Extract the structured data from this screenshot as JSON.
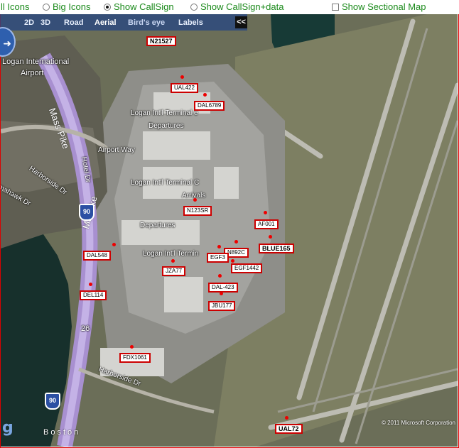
{
  "options": {
    "all_icons": "ll Icons",
    "big_icons": "Big Icons",
    "show_callsign": "Show CallSign",
    "show_callsign_data": "Show CallSign+data",
    "show_sectional_map": "Show Sectional Map"
  },
  "map_toolbar": {
    "view_2d": "2D",
    "view_3d": "3D",
    "road": "Road",
    "aerial": "Aerial",
    "birds_eye": "Bird's eye",
    "labels": "Labels",
    "collapse": "<<"
  },
  "map_labels": {
    "logan_intl": "Logan International",
    "airport": "Airport",
    "terminal_e": "Logan Int'l Terminal e",
    "departures_1": "Departures",
    "airport_way": "Airport Way",
    "terminal_c": "Logan Int'l Terminal C",
    "arrivals": "Arrivals",
    "departures_2": "Departures",
    "terminal_partial": "Logan Int'l Termin",
    "hotel_dr": "Hotel Dr",
    "harborside_dr_1": "Harborside Dr",
    "harborside_dr_2": "Harborside Dr",
    "mahawk_dr": "mahawk Dr",
    "mass_pike_1": "Mass Pike",
    "mass_pike_2": "Ma Pike",
    "interstate_1": "90",
    "interstate_2": "90",
    "exit_26": "26",
    "city": "Boston",
    "copyright": "© 2011 Microsoft Corporation"
  },
  "flights": [
    {
      "callsign": "N21527",
      "bold": true
    },
    {
      "callsign": "UAL422",
      "bold": false
    },
    {
      "callsign": "DAL6789",
      "bold": false
    },
    {
      "callsign": "N123SR",
      "bold": false
    },
    {
      "callsign": "AF001",
      "bold": false
    },
    {
      "callsign": "N892C",
      "bold": false
    },
    {
      "callsign": "BLUE165",
      "bold": true
    },
    {
      "callsign": "EGF3",
      "bold": false
    },
    {
      "callsign": "EGF1442",
      "bold": false
    },
    {
      "callsign": "DAL548",
      "bold": false
    },
    {
      "callsign": "JZA77",
      "bold": false
    },
    {
      "callsign": "DAL-423",
      "bold": false
    },
    {
      "callsign": "DEL114",
      "bold": false
    },
    {
      "callsign": "JBU177",
      "bold": false
    },
    {
      "callsign": "FDX1061",
      "bold": false
    },
    {
      "callsign": "UAL72",
      "bold": true
    }
  ]
}
